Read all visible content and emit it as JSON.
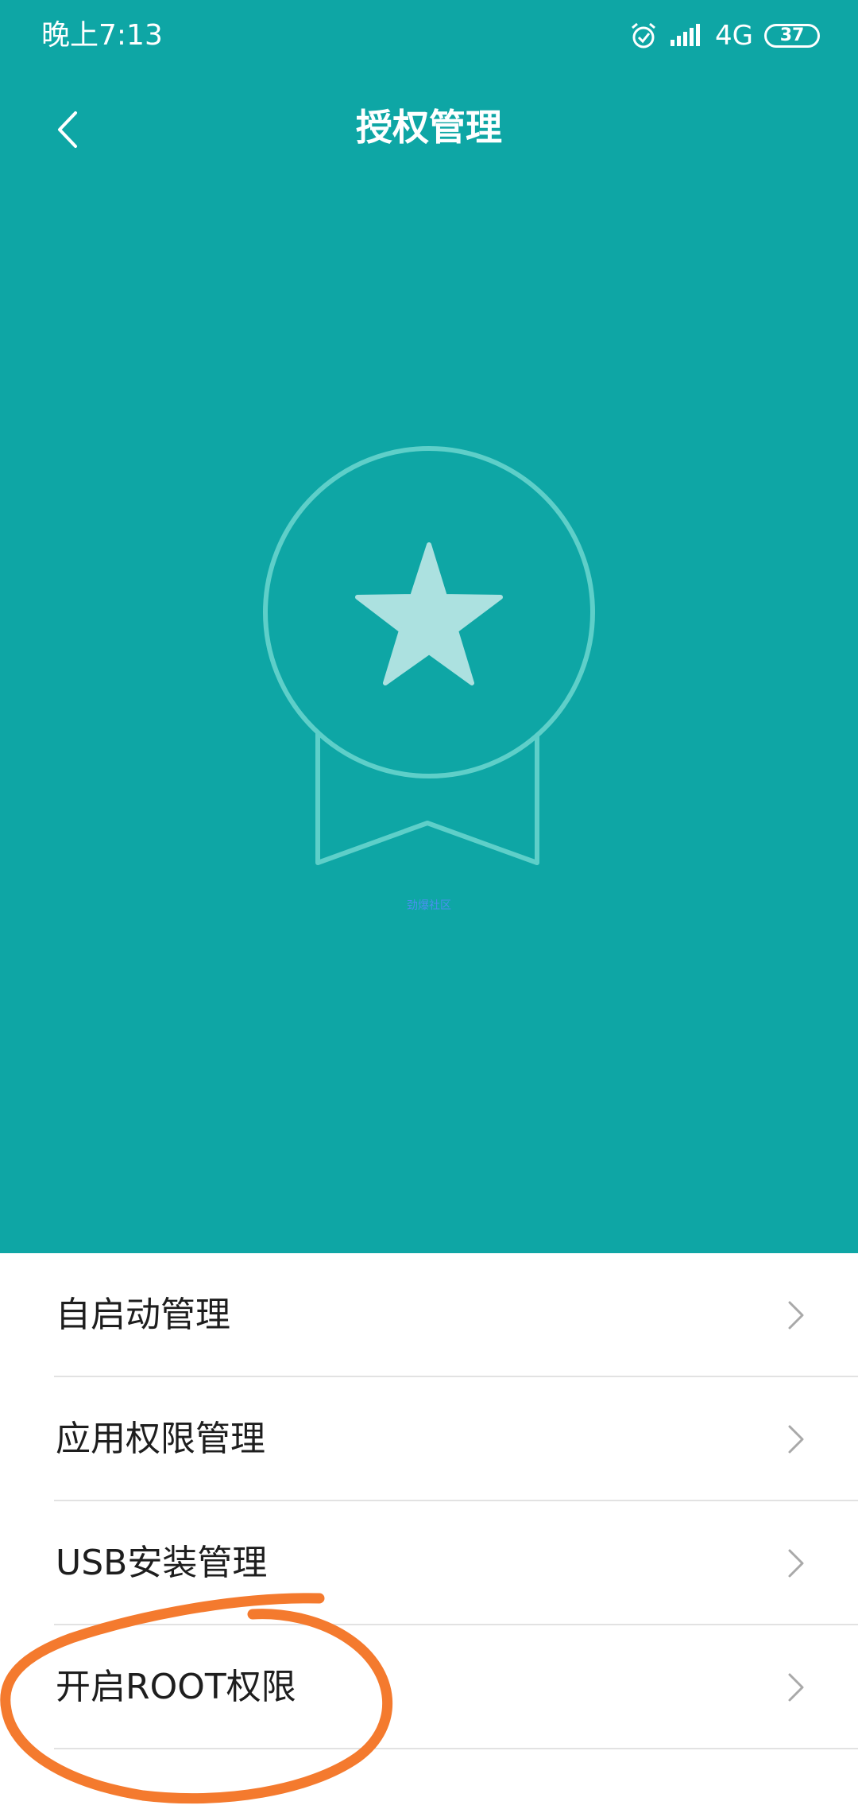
{
  "status_bar": {
    "time": "晚上7:13",
    "network": "4G",
    "battery": "37",
    "icons": [
      "alarm-icon",
      "signal-icon",
      "battery-icon"
    ]
  },
  "header": {
    "title": "授权管理",
    "back_icon": "chevron-left-icon",
    "badge_icon": "medal-star-icon",
    "watermark": "劲爆社区"
  },
  "menu": {
    "items": [
      {
        "label": "自启动管理",
        "icon": "chevron-right-icon"
      },
      {
        "label": "应用权限管理",
        "icon": "chevron-right-icon"
      },
      {
        "label": "USB安装管理",
        "icon": "chevron-right-icon"
      },
      {
        "label": "开启ROOT权限",
        "icon": "chevron-right-icon"
      }
    ]
  },
  "colors": {
    "header_bg": "#0ea6a5",
    "badge_outline": "#5ecfc9",
    "star_fill": "#ace1e0",
    "annotation": "#f47a2e"
  }
}
